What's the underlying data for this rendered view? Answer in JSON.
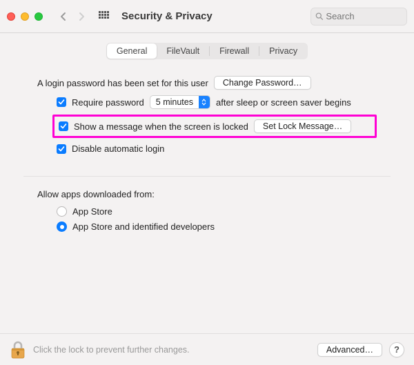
{
  "window": {
    "title": "Security & Privacy",
    "search_placeholder": "Search"
  },
  "tabs": {
    "items": [
      "General",
      "FileVault",
      "Firewall",
      "Privacy"
    ],
    "active": 0
  },
  "general": {
    "password_set_text": "A login password has been set for this user",
    "change_password_btn": "Change Password…",
    "require_password_label": "Require password",
    "require_password_checked": true,
    "delay_value": "5 minutes",
    "after_text": "after sleep or screen saver begins",
    "show_message_label": "Show a message when the screen is locked",
    "show_message_checked": true,
    "set_lock_message_btn": "Set Lock Message…",
    "disable_auto_login_label": "Disable automatic login",
    "disable_auto_login_checked": true
  },
  "downloads": {
    "heading": "Allow apps downloaded from:",
    "options": [
      "App Store",
      "App Store and identified developers"
    ],
    "selected": 1
  },
  "footer": {
    "lock_text": "Click the lock to prevent further changes.",
    "advanced_btn": "Advanced…",
    "help_label": "?"
  }
}
